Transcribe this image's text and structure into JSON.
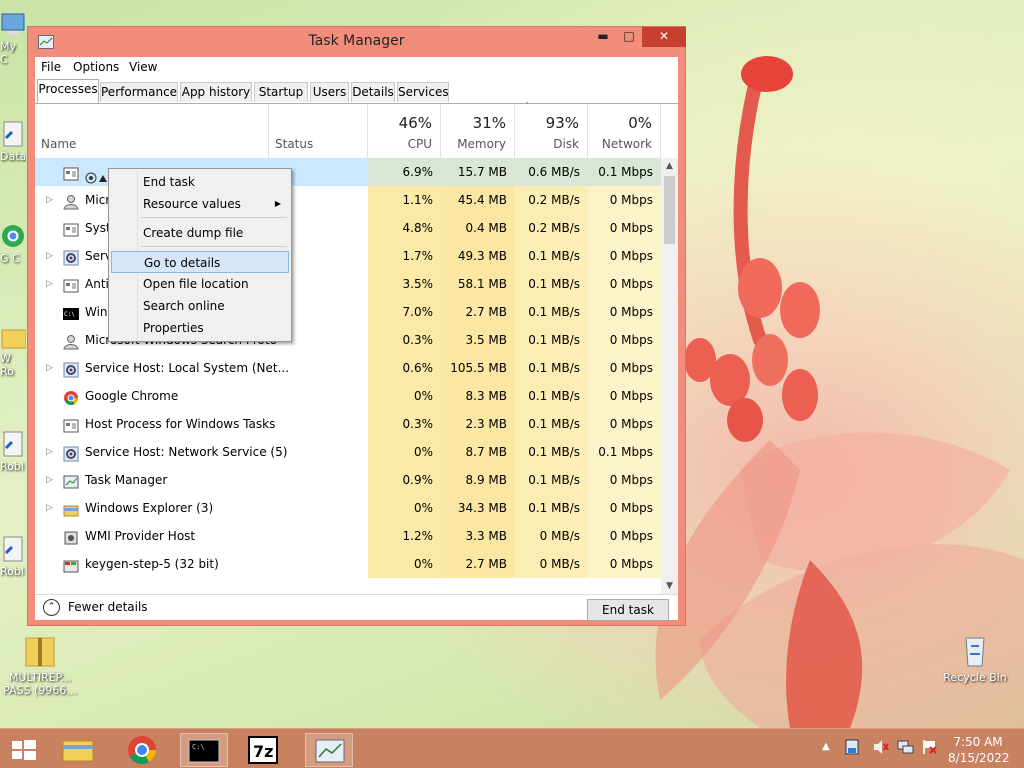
{
  "window": {
    "title": "Task Manager",
    "minimize_glyph": "▬",
    "maximize_glyph": "□",
    "close_glyph": "✕"
  },
  "menu": [
    "File",
    "Options",
    "View"
  ],
  "tabs": [
    "Processes",
    "Performance",
    "App history",
    "Startup",
    "Users",
    "Details",
    "Services"
  ],
  "header": {
    "name": "Name",
    "status": "Status",
    "cpu_pct": "46%",
    "cpu": "CPU",
    "mem_pct": "31%",
    "mem": "Memory",
    "disk_pct": "93%",
    "disk": "Disk",
    "net_pct": "0%",
    "net": "Network"
  },
  "rows": [
    {
      "name": "",
      "cpu": "6.9%",
      "mem": "15.7 MB",
      "disk": "0.6 MB/s",
      "net": "0.1 Mbps",
      "expand": false,
      "icon": "app-icon",
      "selected": true
    },
    {
      "name": "Micr",
      "cpu": "1.1%",
      "mem": "45.4 MB",
      "disk": "0.2 MB/s",
      "net": "0 Mbps",
      "expand": true,
      "icon": "user-icon"
    },
    {
      "name": "Syste",
      "cpu": "4.8%",
      "mem": "0.4 MB",
      "disk": "0.2 MB/s",
      "net": "0 Mbps",
      "expand": false,
      "icon": "app-icon"
    },
    {
      "name": "Servi",
      "cpu": "1.7%",
      "mem": "49.3 MB",
      "disk": "0.1 MB/s",
      "net": "0 Mbps",
      "expand": true,
      "icon": "gear-icon"
    },
    {
      "name": "Anti",
      "cpu": "3.5%",
      "mem": "58.1 MB",
      "disk": "0.1 MB/s",
      "net": "0 Mbps",
      "expand": true,
      "icon": "app-icon"
    },
    {
      "name": "Wind",
      "cpu": "7.0%",
      "mem": "2.7 MB",
      "disk": "0.1 MB/s",
      "net": "0 Mbps",
      "expand": false,
      "icon": "console-icon"
    },
    {
      "name": "Microsoft Windows Search Proto",
      "cpu": "0.3%",
      "mem": "3.5 MB",
      "disk": "0.1 MB/s",
      "net": "0 Mbps",
      "expand": false,
      "icon": "user-icon"
    },
    {
      "name": "Service Host: Local System (Net...",
      "cpu": "0.6%",
      "mem": "105.5 MB",
      "disk": "0.1 MB/s",
      "net": "0 Mbps",
      "expand": true,
      "icon": "gear-icon"
    },
    {
      "name": "Google Chrome",
      "cpu": "0%",
      "mem": "8.3 MB",
      "disk": "0.1 MB/s",
      "net": "0 Mbps",
      "expand": false,
      "icon": "chrome-icon"
    },
    {
      "name": "Host Process for Windows Tasks",
      "cpu": "0.3%",
      "mem": "2.3 MB",
      "disk": "0.1 MB/s",
      "net": "0 Mbps",
      "expand": false,
      "icon": "app-icon"
    },
    {
      "name": "Service Host: Network Service (5)",
      "cpu": "0%",
      "mem": "8.7 MB",
      "disk": "0.1 MB/s",
      "net": "0.1 Mbps",
      "expand": true,
      "icon": "gear-icon"
    },
    {
      "name": "Task Manager",
      "cpu": "0.9%",
      "mem": "8.9 MB",
      "disk": "0.1 MB/s",
      "net": "0 Mbps",
      "expand": true,
      "icon": "taskmgr-icon"
    },
    {
      "name": "Windows Explorer (3)",
      "cpu": "0%",
      "mem": "34.3 MB",
      "disk": "0.1 MB/s",
      "net": "0 Mbps",
      "expand": true,
      "icon": "folder-icon"
    },
    {
      "name": "WMI Provider Host",
      "cpu": "1.2%",
      "mem": "3.3 MB",
      "disk": "0 MB/s",
      "net": "0 Mbps",
      "expand": false,
      "icon": "wmi-icon"
    },
    {
      "name": "keygen-step-5 (32 bit)",
      "cpu": "0%",
      "mem": "2.7 MB",
      "disk": "0 MB/s",
      "net": "0 Mbps",
      "expand": false,
      "icon": "keygen-icon"
    }
  ],
  "context_menu": {
    "end_task": "End task",
    "resource_values": "Resource values",
    "create_dump": "Create dump file",
    "go_to_details": "Go to details",
    "open_file_location": "Open file location",
    "search_online": "Search online",
    "properties": "Properties"
  },
  "footer": {
    "fewer_details": "Fewer details",
    "end_task": "End task"
  },
  "desktop_icons": {
    "multirep": "MULTIREP... PASS (9966...",
    "recycle_bin": "Recycle Bin",
    "edge_labels": [
      "My C",
      "Data",
      "G C",
      "W Ro",
      "Robl",
      "Robl"
    ]
  },
  "taskbar": {
    "time": "7:50 AM",
    "date": "8/15/2022",
    "apps": [
      "start-button",
      "file-explorer",
      "google-chrome",
      "command-prompt",
      "7-zip",
      "task-manager"
    ],
    "tray": [
      "show-hidden-icons",
      "action-center",
      "volume-muted",
      "network",
      "flag"
    ]
  },
  "colors": {
    "accent_frame": "#f28d7c",
    "close_button": "#c7402f",
    "selection": "#cce8ff",
    "heat": "#fbe9a8"
  }
}
